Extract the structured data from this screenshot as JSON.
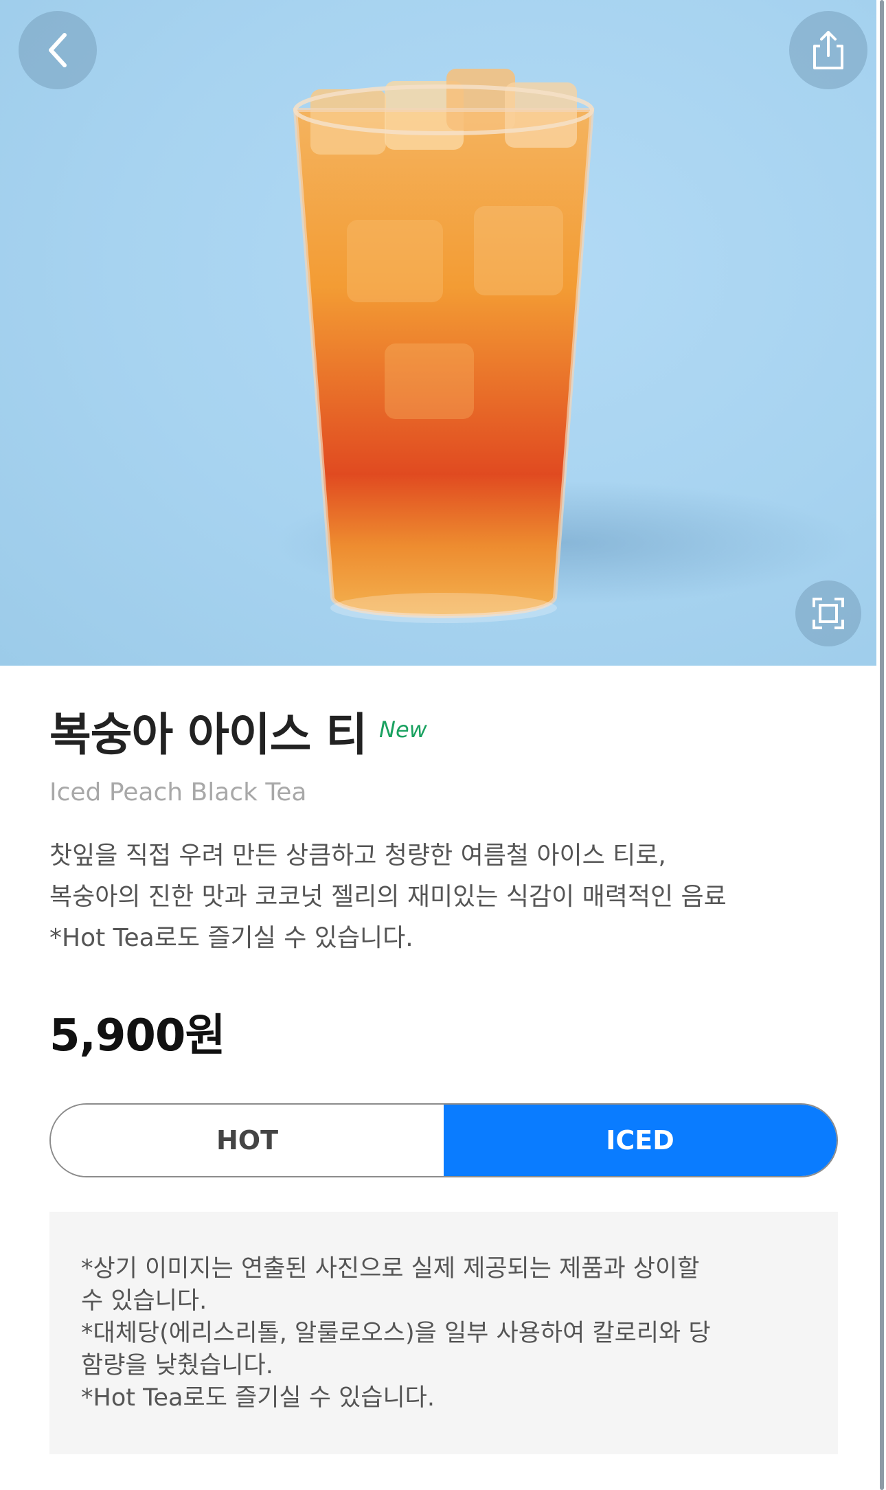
{
  "product": {
    "name_ko": "복숭아 아이스 티",
    "badge": "New",
    "name_en": "Iced Peach Black Tea",
    "description_lines": [
      "찻잎을 직접 우려 만든 상큼하고 청량한 여름철 아이스 티로,",
      "복숭아의 진한 맛과 코코넛 젤리의 재미있는 식감이 매력적인 음료",
      "*Hot Tea로도 즐기실 수 있습니다."
    ],
    "price": "5,900원"
  },
  "temperature_toggle": {
    "options": [
      "HOT",
      "ICED"
    ],
    "selected": "ICED"
  },
  "notice_lines": [
    "*상기 이미지는 연출된 사진으로 실제 제공되는 제품과 상이할",
    "수 있습니다.",
    "*대체당(에리스리톨, 알룰로오스)을 일부 사용하여 칼로리와 당",
    "함량을 낮췄습니다.",
    "*Hot Tea로도 즐기실 수 있습니다."
  ],
  "icons": {
    "back": "chevron-left-icon",
    "share": "share-icon",
    "expand": "expand-icon"
  },
  "colors": {
    "accent": "#0a7cff",
    "new_badge": "#1aa160",
    "hero_background": "#a7d3f0"
  }
}
